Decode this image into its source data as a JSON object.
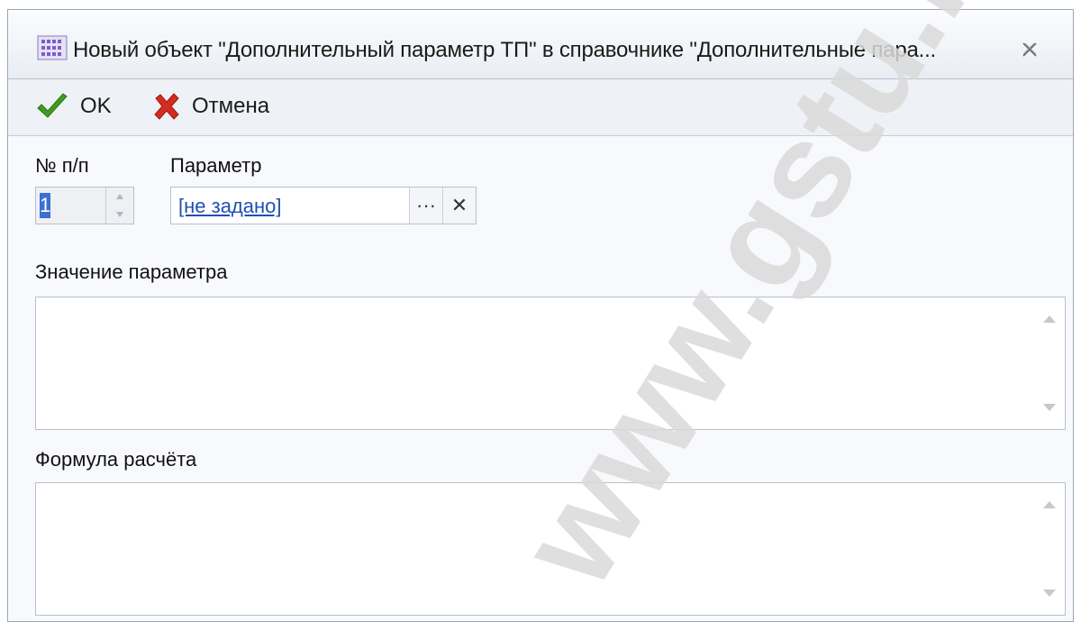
{
  "window": {
    "title": "Новый объект \"Дополнительный параметр ТП\" в справочнике \"Дополнительные пара...",
    "close_glyph": "✕"
  },
  "toolbar": {
    "ok_label": "OK",
    "cancel_label": "Отмена"
  },
  "form": {
    "number_label": "№ п/п",
    "number_value": "1",
    "parameter_label": "Параметр",
    "parameter_value": "[не задано]",
    "browse_glyph": "···",
    "clear_glyph": "✕",
    "value_label": "Значение параметра",
    "formula_label": "Формула расчёта"
  },
  "watermark": {
    "text": "www.gstu.by"
  },
  "colors": {
    "accent": "#3b6fd4",
    "link": "#1f4fb5",
    "ok_check": "#3f9d1f",
    "cancel_x": "#d62b1f",
    "watermark": "#d9d9d9"
  },
  "icons": [
    "app-grid-icon",
    "close-icon",
    "checkmark-icon",
    "cancel-x-icon",
    "spin-up-icon",
    "spin-down-icon",
    "ellipsis-icon",
    "clear-icon",
    "scroll-up-icon",
    "scroll-down-icon"
  ]
}
